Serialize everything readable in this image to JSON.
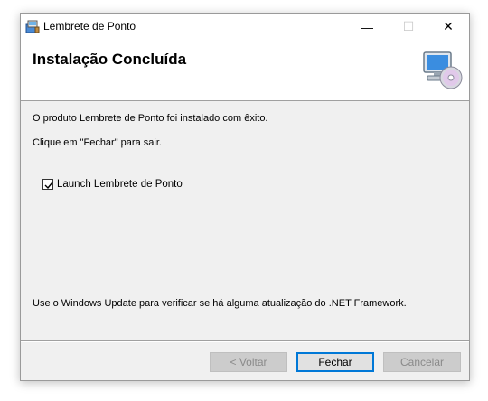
{
  "window": {
    "title": "Lembrete de Ponto",
    "controls": {
      "minimize": "—",
      "maximize": "☐",
      "close": "✕"
    }
  },
  "header": {
    "title": "Instalação Concluída",
    "icon": "computer-cd-icon"
  },
  "content": {
    "line1": "O produto Lembrete de Ponto foi instalado com êxito.",
    "line2": "Clique em \"Fechar\" para sair.",
    "checkbox_label": "Launch Lembrete de Ponto",
    "checkbox_checked": true,
    "footer_note": "Use o Windows Update para verificar se há alguma atualização do .NET Framework."
  },
  "buttons": {
    "back": "< Voltar",
    "close": "Fechar",
    "cancel": "Cancelar"
  }
}
